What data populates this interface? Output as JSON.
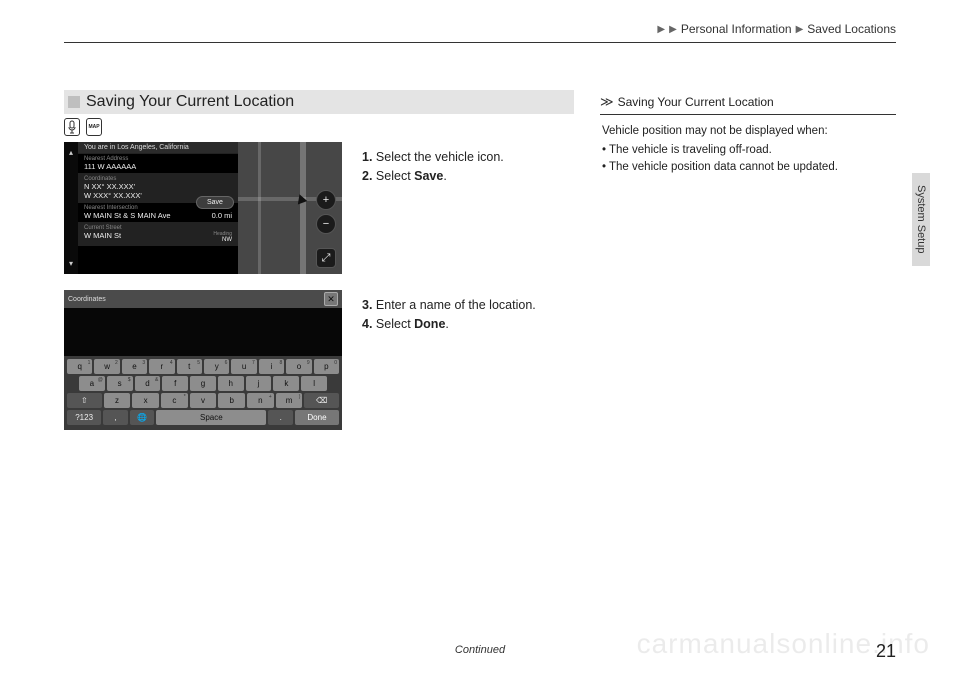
{
  "breadcrumb": {
    "level1": "Personal Information",
    "level2": "Saved Locations"
  },
  "side_tab": "System Setup",
  "heading": "Saving Your Current Location",
  "icons": {
    "voice": "voice-icon",
    "map": "MAP"
  },
  "screenshot1": {
    "top_bar": "You are in Los Angeles, California",
    "nearest_address_label": "Nearest Address",
    "nearest_address_value": "111 W AAAAAA",
    "coordinates_label": "Coordinates",
    "coordinates_value1": "N XX° XX.XXX'",
    "coordinates_value2": "W XXX° XX.XXX'",
    "nearest_intersection_label": "Nearest Intersection",
    "nearest_intersection_value": "W MAIN St & S MAIN Ave",
    "nearest_intersection_dist": "0.0 mi",
    "current_street_label": "Current Street",
    "current_street_value": "W MAIN St",
    "heading_label": "Heading",
    "heading_value": "NW",
    "save_button": "Save",
    "plus": "+",
    "minus": "−",
    "fullscreen": "⤢"
  },
  "instructions1": [
    {
      "num": "1.",
      "text_a": "Select the vehicle icon."
    },
    {
      "num": "2.",
      "text_a": "Select ",
      "bold": "Save",
      "text_b": "."
    }
  ],
  "screenshot2": {
    "field_label": "Coordinates",
    "close": "✕",
    "rows": {
      "r1": [
        "q",
        "w",
        "e",
        "r",
        "t",
        "y",
        "u",
        "i",
        "o",
        "p"
      ],
      "r1sup": [
        "1",
        "2",
        "3",
        "4",
        "5",
        "6",
        "7",
        "8",
        "9",
        "0"
      ],
      "r2": [
        "a",
        "s",
        "d",
        "f",
        "g",
        "h",
        "j",
        "k",
        "l"
      ],
      "r2sup": [
        "@",
        "$",
        "&",
        "",
        "",
        "",
        "",
        "",
        ""
      ],
      "r3_shift": "⇧",
      "r3": [
        "z",
        "x",
        "c",
        "v",
        "b",
        "n",
        "m"
      ],
      "r3sup": [
        "",
        "",
        "*",
        "",
        "",
        "+",
        ")"
      ],
      "r3_back": "⌫",
      "r4": {
        "sym": "?123",
        "comma": ",",
        "globe": "🌐",
        "space": "Space",
        "period": ".",
        "done": "Done"
      }
    }
  },
  "instructions2": [
    {
      "num": "3.",
      "text_a": "Enter a name of the location."
    },
    {
      "num": "4.",
      "text_a": "Select ",
      "bold": "Done",
      "text_b": "."
    }
  ],
  "sidebar_note": {
    "icon": "≫",
    "title": "Saving Your Current Location",
    "intro": "Vehicle position may not be displayed when:",
    "bullets": [
      "The vehicle is traveling off-road.",
      "The vehicle position data cannot be updated."
    ]
  },
  "footer": {
    "continued": "Continued",
    "page": "21"
  },
  "watermark": "carmanualsonline.info"
}
